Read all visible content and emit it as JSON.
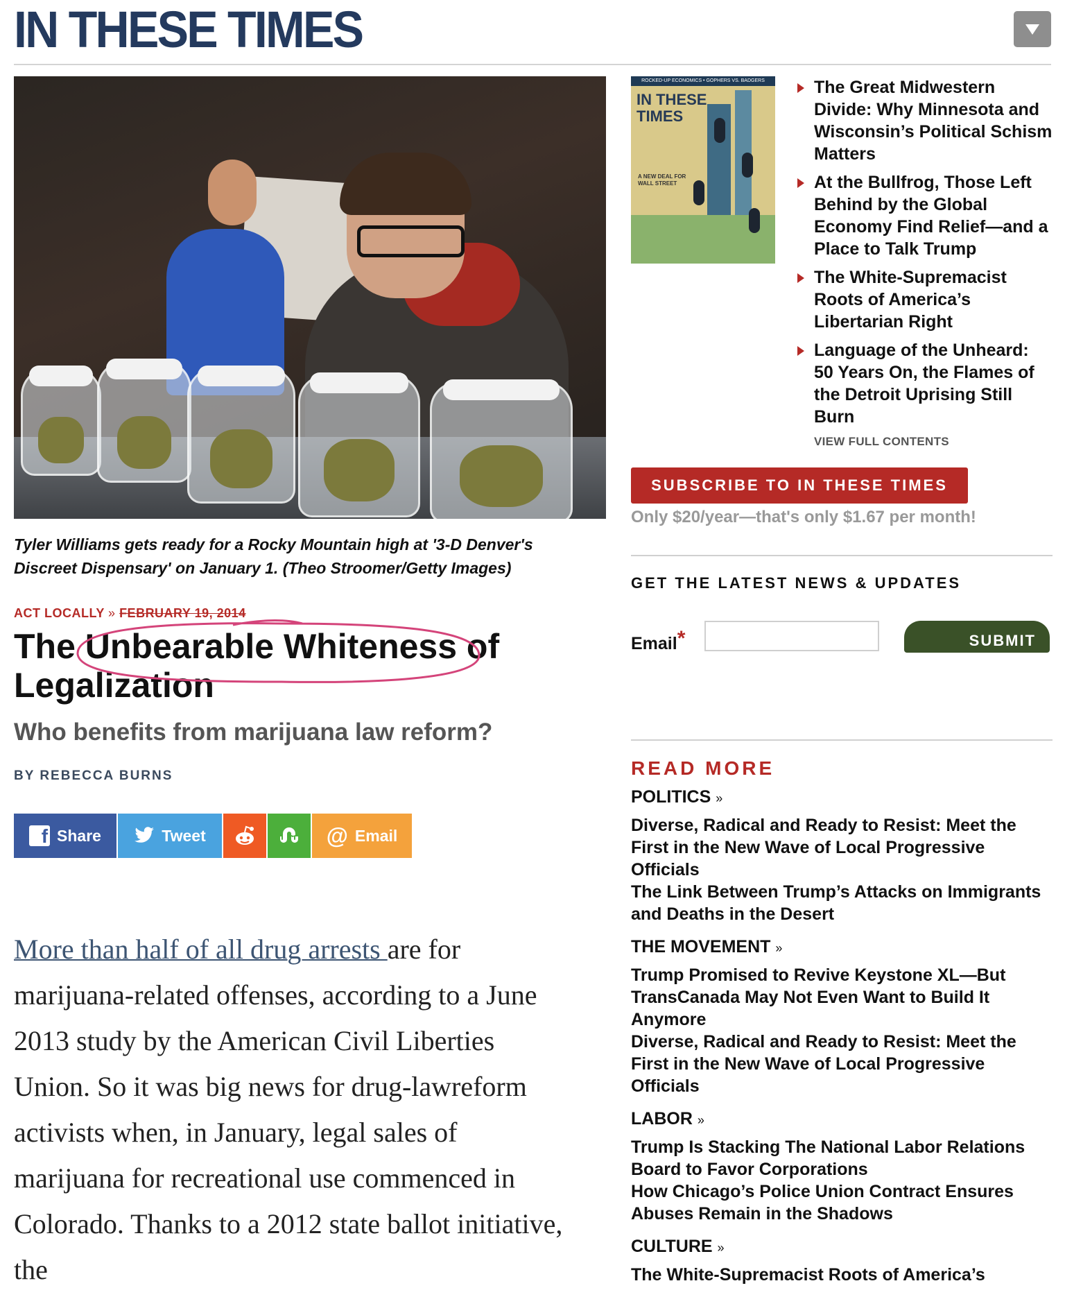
{
  "header": {
    "logo": "IN THESE TIMES",
    "menu_icon": "chevron-down-icon"
  },
  "hero": {
    "caption": "Tyler Williams gets ready for a Rocky Mountain high at '3-D Denver's Discreet Dispensary' on January 1. (Theo Stroomer/Getty Images)"
  },
  "article": {
    "section": "ACT LOCALLY",
    "separator": "»",
    "date": "FEBRUARY 19, 2014",
    "title": "The Unbearable Whiteness of Legalization",
    "subtitle": "Who benefits from marijuana law reform?",
    "byline": "BY REBECCA BURNS",
    "body_link": "More than half of all drug arrests ",
    "body_text": "are for marijuana-related offenses, according to a June 2013 study by the American Civil Liberties Union. So it was big news for drug-lawreform activists when, in January, legal sales of marijuana for recreational use commenced in Colorado. Thanks to a 2012 state ballot initiative, the"
  },
  "share": {
    "facebook": "Share",
    "twitter": "Tweet",
    "email": "Email",
    "colors": {
      "facebook": "#3b5aa0",
      "twitter": "#4aa3df",
      "reddit": "#ef5a24",
      "stumbleupon": "#4caf3b",
      "email": "#f4a23c"
    }
  },
  "sidebar": {
    "cover": {
      "top_line": "ROCKED-UP ECONOMICS • GOPHERS VS. BADGERS",
      "name_line1": "IN THESE",
      "name_line2": "TIMES",
      "tagline": "A NEW DEAL FOR WALL STREET"
    },
    "toc": [
      "The Great Midwestern Divide: Why Minnesota and Wisconsin’s Political Schism Matters",
      "At the Bullfrog, Those Left Behind by the Global Economy Find Relief—and a Place to Talk Trump",
      "The White-Supremacist Roots of America’s Libertarian Right",
      "Language of the Unheard: 50 Years On, the Flames of the Detroit Uprising Still Burn"
    ],
    "view_full": "VIEW FULL CONTENTS",
    "subscribe": "SUBSCRIBE TO IN THESE TIMES",
    "price": "Only $20/year—that's only $1.67 per month!",
    "newsletter_heading": "GET THE LATEST NEWS & UPDATES",
    "email_label": "Email",
    "required_mark": "*",
    "submit": "SUBMIT",
    "read_more": "READ MORE",
    "sections": [
      {
        "name": "POLITICS",
        "links": [
          "Diverse, Radical and Ready to Resist: Meet the First in the New Wave of Local Progressive Officials",
          "The Link Between Trump’s Attacks on Immigrants and Deaths in the Desert"
        ]
      },
      {
        "name": "THE MOVEMENT",
        "links": [
          "Trump Promised to Revive Keystone XL—But TransCanada May Not Even Want to Build It Anymore",
          "Diverse, Radical and Ready to Resist: Meet the First in the New Wave of Local Progressive Officials"
        ]
      },
      {
        "name": "LABOR",
        "links": [
          "Trump Is Stacking The National Labor Relations Board to Favor Corporations",
          "How Chicago’s Police Union Contract Ensures Abuses Remain in the Shadows"
        ]
      },
      {
        "name": "CULTURE",
        "links": [
          "The White-Supremacist Roots of America’s"
        ]
      }
    ]
  }
}
